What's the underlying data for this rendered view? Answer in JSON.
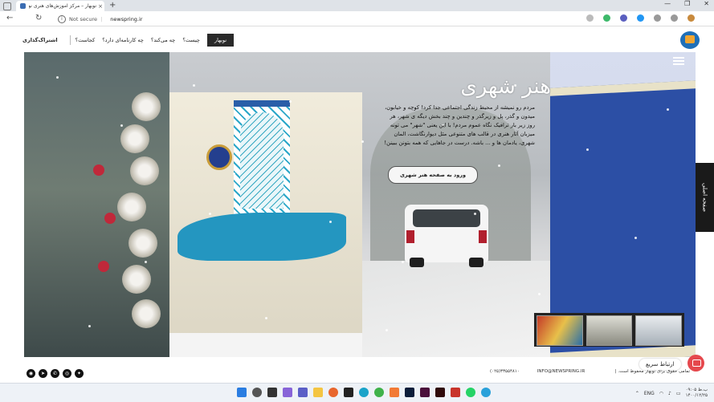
{
  "browser": {
    "tab_title": "نوبهار – مرکز آموزش‌های هنری نو...",
    "tab_close": "×",
    "new_tab": "+",
    "security": "Not secure",
    "url": "newspring.ir",
    "window_controls": [
      "—",
      "❐",
      "✕"
    ],
    "icons": [
      "back-icon",
      "refresh-icon",
      "info-icon",
      "star-icon",
      "collections-icon",
      "profile-icon"
    ]
  },
  "site": {
    "nav": {
      "subscription": "اشتراک‌گذاری",
      "items": [
        "کجاست؟",
        "چه کارنامه‌ای دارد؟",
        "چه می‌کند؟",
        "چیست؟"
      ],
      "active": "نوبهار"
    }
  },
  "hero": {
    "title": "هنر شهری",
    "description": "مردم رو نمیشه از محیط زندگی اجتماعی جدا کرد! کوچه و خیابون، میدون و گذر، پل و زیرگذر و چندین و چند بخش دیگه ی شهر، هر روز زیر بار ترافیک نگاه عموم مردم! با این یعنی \"شهر\" می تونه میزبان آثار هنری در قالب های متنوعی مثل دیوارنگاشت، المان شهری، یادمان ها و ... باشه. درست در جاهایی که همه بتونن ببینن!",
    "button": "ورود به صفحه هنر شهری",
    "side_tab": "صفحه اصلی"
  },
  "footer": {
    "phone": "(۰۲۵)۳۳۵۵۴۸۱۰",
    "email": "INFO@NEWSPRING.IR",
    "copyright": "تمامی حقوق برای نوبهار محفوظ است. |",
    "quick_contact": "ارتباط سریع",
    "social": [
      "twitter-icon",
      "instagram-icon",
      "whatsapp-icon",
      "telegram-icon",
      "aparat-icon"
    ]
  },
  "taskbar": {
    "lang": "ENG",
    "time": "ب.ظ ۰۹:۰۵",
    "date": "۱۴۰۰/۱۲/۲۵"
  },
  "colors": {
    "dark": "#2a2a2a",
    "accent": "#e5484d",
    "brand": "#1e6fb8"
  }
}
